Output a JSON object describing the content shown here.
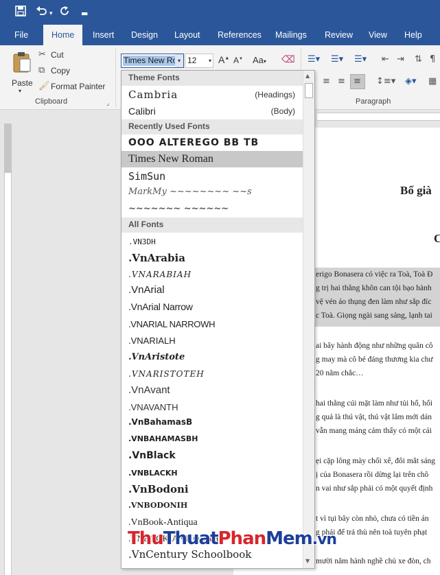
{
  "qat": {
    "save_icon": "save-icon",
    "undo_icon": "undo-icon",
    "redo_icon": "redo-icon",
    "customize_icon": "customize-qat-icon"
  },
  "tabs": [
    "File",
    "Home",
    "Insert",
    "Design",
    "Layout",
    "References",
    "Mailings",
    "Review",
    "View",
    "Help"
  ],
  "active_tab": "Home",
  "clipboard": {
    "paste": "Paste",
    "cut": "Cut",
    "copy": "Copy",
    "format_painter": "Format Painter",
    "group": "Clipboard"
  },
  "font": {
    "name": "Times New Ro",
    "size": "12",
    "case_label": "Aa"
  },
  "paragraph_group": "Paragraph",
  "dropdown": {
    "theme_header": "Theme Fonts",
    "theme_fonts": [
      {
        "name": "Cambria",
        "tag": "(Headings)"
      },
      {
        "name": "Calibri",
        "tag": "(Body)"
      }
    ],
    "recent_header": "Recently Used Fonts",
    "recent_fonts": [
      "OOO ALTEREGO BB TB",
      "Times New Roman",
      "SimSun",
      "MarkMy ~~~~~~~~ ~~s",
      "~~~~~~~ ~~~~~~"
    ],
    "all_header": "All Fonts",
    "all_fonts": [
      ".VN3DH",
      ".VnArabia",
      ".VNARABIAH",
      ".VnArial",
      ".VnArial Narrow",
      ".VNARIAL NARROWH",
      ".VNARIALH",
      ".VnAristote",
      ".VNARISTOTEH",
      ".VnAvant",
      ".VNAVANTH",
      ".VnBahamasB",
      ".VNBAHAMASBH",
      ".VnBlack",
      ".VNBLACKH",
      ".VnBodoni",
      ".VNBODONIH",
      ".VnBook-Antiqua",
      ".VNBOOK-ANTIQUAH",
      ".VnCentury Schoolbook"
    ]
  },
  "document": {
    "title": "Bố già",
    "chapter": "C",
    "lines": [
      "erigo Bonasera có việc ra Toà, Toà Đ",
      "g trị hai thằng khôn can tội bạo hành",
      "vệ vén áo thụng đen làm như sắp đíc",
      "c Toà. Giọng ngài sang sảng, lạnh tai",
      "ai bây hành động như những quân cô",
      "g may mà cô bé đáng thương kia chư",
      "20 năm chắc…",
      "hai thằng cúi mặt làm như tủi hổ, hối",
      "g quả là thú vật, thú vật lâm mới dán",
      "vẫn mang máng cảm thấy có một cái",
      "ẹi cặp lông mày chổi xể, đôi mắt sáng",
      "ị của Bonasera rồi dừng lại trên chô",
      "n vai như sắp phải có một quyết định",
      "t vì tụi bây còn nhỏ, chưa có tiền án",
      "g phải để trả thù nên toà tuyên phạt",
      "mười năm hành nghề chủ xe đòn, ch"
    ]
  },
  "watermark": {
    "part1": "Thu",
    "part2": "Thuat",
    "part3": "Phan",
    "part4": "Mem",
    "part5": ".vn"
  },
  "colors": {
    "accent": "#2b579a",
    "wm_red": "#d7262c",
    "wm_blue": "#1e3f99"
  }
}
